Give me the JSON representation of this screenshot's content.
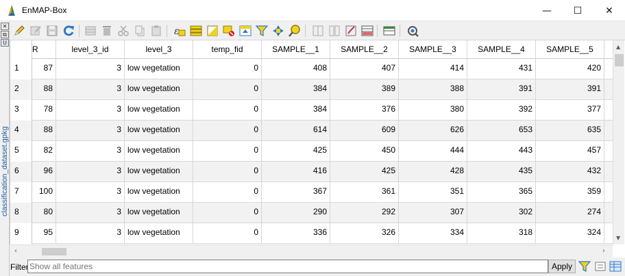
{
  "window": {
    "title": "EnMAP-Box",
    "minimize_glyph": "—",
    "maximize_glyph": "☐",
    "close_glyph": "✕"
  },
  "dock": {
    "vertical_label": "classification_dataset.gpkg",
    "buttons": [
      "✕",
      "⧉",
      "U"
    ]
  },
  "toolbar": {
    "icons": [
      "edit-pencil-icon",
      "multi-edit-icon",
      "save-icon",
      "reload-icon",
      "add-feature-icon",
      "delete-feature-icon",
      "cut-icon",
      "copy-icon",
      "paste-icon",
      "select-by-expression-icon",
      "select-all-icon",
      "invert-selection-icon",
      "deselect-icon",
      "move-selection-to-top-icon",
      "filter-icon",
      "pan-to-selection-icon",
      "zoom-to-selection-icon",
      "new-field-icon",
      "delete-field-icon",
      "field-calculator-icon",
      "conditional-formatting-icon",
      "dock-attribute-table-icon",
      "actions-icon"
    ]
  },
  "table": {
    "columns": [
      "R",
      "level_3_id",
      "level_3",
      "temp_fid",
      "SAMPLE__1",
      "SAMPLE__2",
      "SAMPLE__3",
      "SAMPLE__4",
      "SAMPLE__5"
    ],
    "rows": [
      {
        "n": "1",
        "R": "87",
        "level_3_id": "3",
        "level_3": "low vegetation",
        "temp_fid": "0",
        "s1": "408",
        "s2": "407",
        "s3": "414",
        "s4": "431",
        "s5": "420"
      },
      {
        "n": "2",
        "R": "88",
        "level_3_id": "3",
        "level_3": "low vegetation",
        "temp_fid": "0",
        "s1": "384",
        "s2": "389",
        "s3": "388",
        "s4": "391",
        "s5": "391"
      },
      {
        "n": "3",
        "R": "78",
        "level_3_id": "3",
        "level_3": "low vegetation",
        "temp_fid": "0",
        "s1": "384",
        "s2": "376",
        "s3": "380",
        "s4": "392",
        "s5": "377"
      },
      {
        "n": "4",
        "R": "88",
        "level_3_id": "3",
        "level_3": "low vegetation",
        "temp_fid": "0",
        "s1": "614",
        "s2": "609",
        "s3": "626",
        "s4": "653",
        "s5": "635"
      },
      {
        "n": "5",
        "R": "82",
        "level_3_id": "3",
        "level_3": "low vegetation",
        "temp_fid": "0",
        "s1": "425",
        "s2": "450",
        "s3": "444",
        "s4": "443",
        "s5": "457"
      },
      {
        "n": "6",
        "R": "96",
        "level_3_id": "3",
        "level_3": "low vegetation",
        "temp_fid": "0",
        "s1": "416",
        "s2": "425",
        "s3": "428",
        "s4": "435",
        "s5": "432"
      },
      {
        "n": "7",
        "R": "100",
        "level_3_id": "3",
        "level_3": "low vegetation",
        "temp_fid": "0",
        "s1": "367",
        "s2": "361",
        "s3": "351",
        "s4": "365",
        "s5": "359"
      },
      {
        "n": "8",
        "R": "80",
        "level_3_id": "3",
        "level_3": "low vegetation",
        "temp_fid": "0",
        "s1": "290",
        "s2": "292",
        "s3": "307",
        "s4": "302",
        "s5": "274"
      },
      {
        "n": "9",
        "R": "95",
        "level_3_id": "3",
        "level_3": "low vegetation",
        "temp_fid": "0",
        "s1": "336",
        "s2": "326",
        "s3": "334",
        "s4": "318",
        "s5": "324"
      }
    ]
  },
  "filter": {
    "label": "Filter",
    "placeholder": "Show all features",
    "apply_label": "Apply",
    "icons": [
      "filter-icon",
      "form-view-icon",
      "table-view-icon"
    ]
  },
  "colors": {
    "row_alt": "#f2f2f2",
    "accent_blue": "#1f5fa8"
  }
}
